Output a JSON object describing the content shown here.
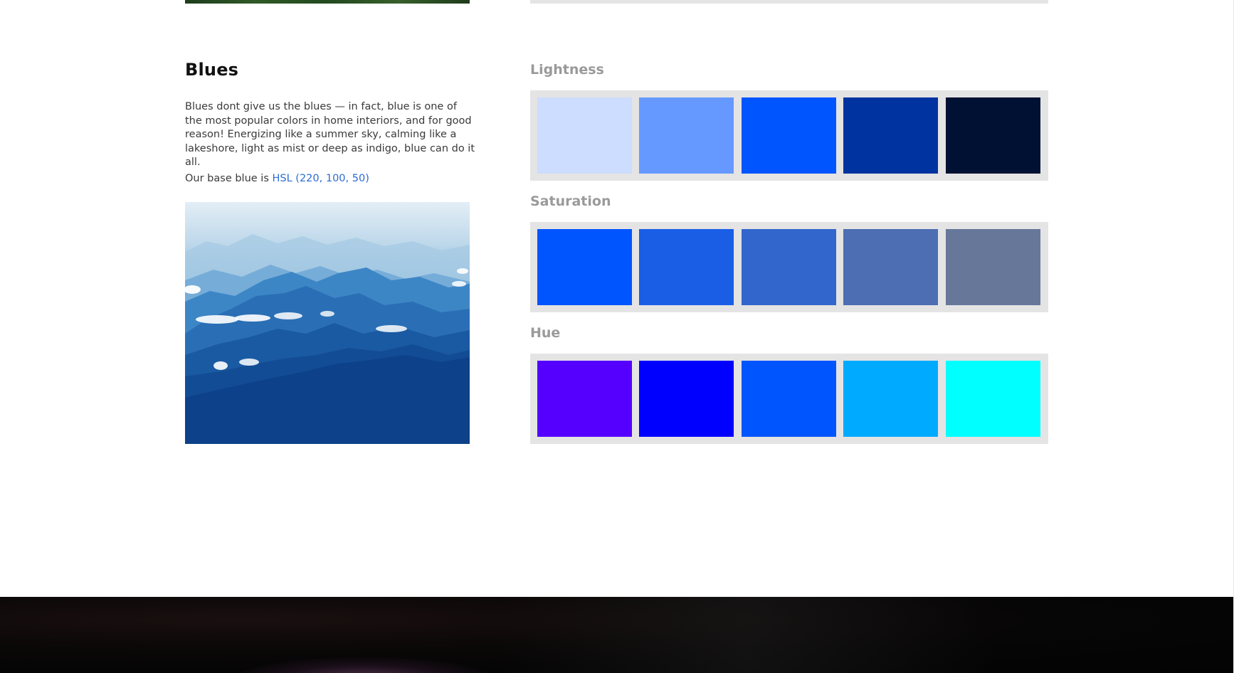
{
  "section": {
    "title": "Blues",
    "description": "Blues dont give us the blues — in fact, blue is one of the most popular colors in home interiors, and for good reason! Energizing like a summer sky, calming like a lakeshore, light as mist or deep as indigo, blue can do it all.",
    "base_prefix": "Our base blue is ",
    "base_link": "HSL (220, 100, 50)"
  },
  "groups": {
    "lightness": {
      "label": "Lightness",
      "colors": [
        "#ccddff",
        "#6699ff",
        "#0055ff",
        "#0033a0",
        "#001133"
      ]
    },
    "saturation": {
      "label": "Saturation",
      "colors": [
        "#0055ff",
        "#1a5ee6",
        "#3366cc",
        "#4d6eb3",
        "#667799"
      ]
    },
    "hue": {
      "label": "Hue",
      "colors": [
        "#5500ff",
        "#0000ff",
        "#0055ff",
        "#00aaff",
        "#00ffff"
      ]
    }
  },
  "colors": {
    "link": "#2b6cd4",
    "label": "#9a9a9a",
    "panel": "#e4e4e4"
  }
}
